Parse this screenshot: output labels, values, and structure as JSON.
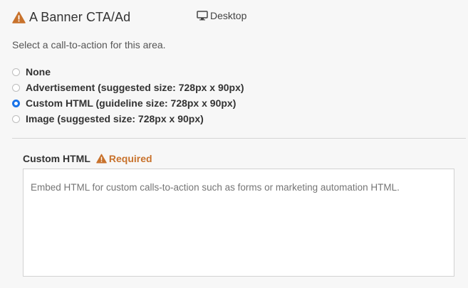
{
  "header": {
    "title": "A Banner CTA/Ad",
    "device_label": "Desktop"
  },
  "description": "Select a call-to-action for this area.",
  "options": [
    {
      "label": "None",
      "checked": false
    },
    {
      "label": "Advertisement (suggested size: 728px x 90px)",
      "checked": false
    },
    {
      "label": "Custom HTML (guideline size: 728px x 90px)",
      "checked": true
    },
    {
      "label": "Image (suggested size: 728px x 90px)",
      "checked": false
    }
  ],
  "field": {
    "label": "Custom HTML",
    "required_label": "Required",
    "placeholder": "Embed HTML for custom calls-to-action such as forms or marketing automation HTML.",
    "value": ""
  },
  "colors": {
    "warning": "#c8722c",
    "radio_checked": "#1a73e8"
  }
}
